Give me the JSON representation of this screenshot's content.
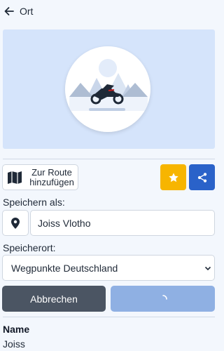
{
  "header": {
    "title": "Ort",
    "back_icon": "arrow-left-icon"
  },
  "hero": {
    "image": "motorcycle-mountains-illustration"
  },
  "actions": {
    "route_label": "Zur Route hinzufügen",
    "route_icon": "map-icon",
    "favorite_icon": "star-icon",
    "share_icon": "share-icon",
    "favorite_color": "#f7b500",
    "share_color": "#2a62c9"
  },
  "save_as": {
    "label": "Speichern als:",
    "value": "Joiss Vlotho",
    "pin_icon": "map-pin-icon"
  },
  "location": {
    "label": "Speicherort:",
    "selected": "Wegpunkte Deutschland"
  },
  "buttons": {
    "cancel": "Abbrechen",
    "save_state": "loading"
  },
  "details": {
    "name_label": "Name",
    "name_value": "Joiss"
  }
}
